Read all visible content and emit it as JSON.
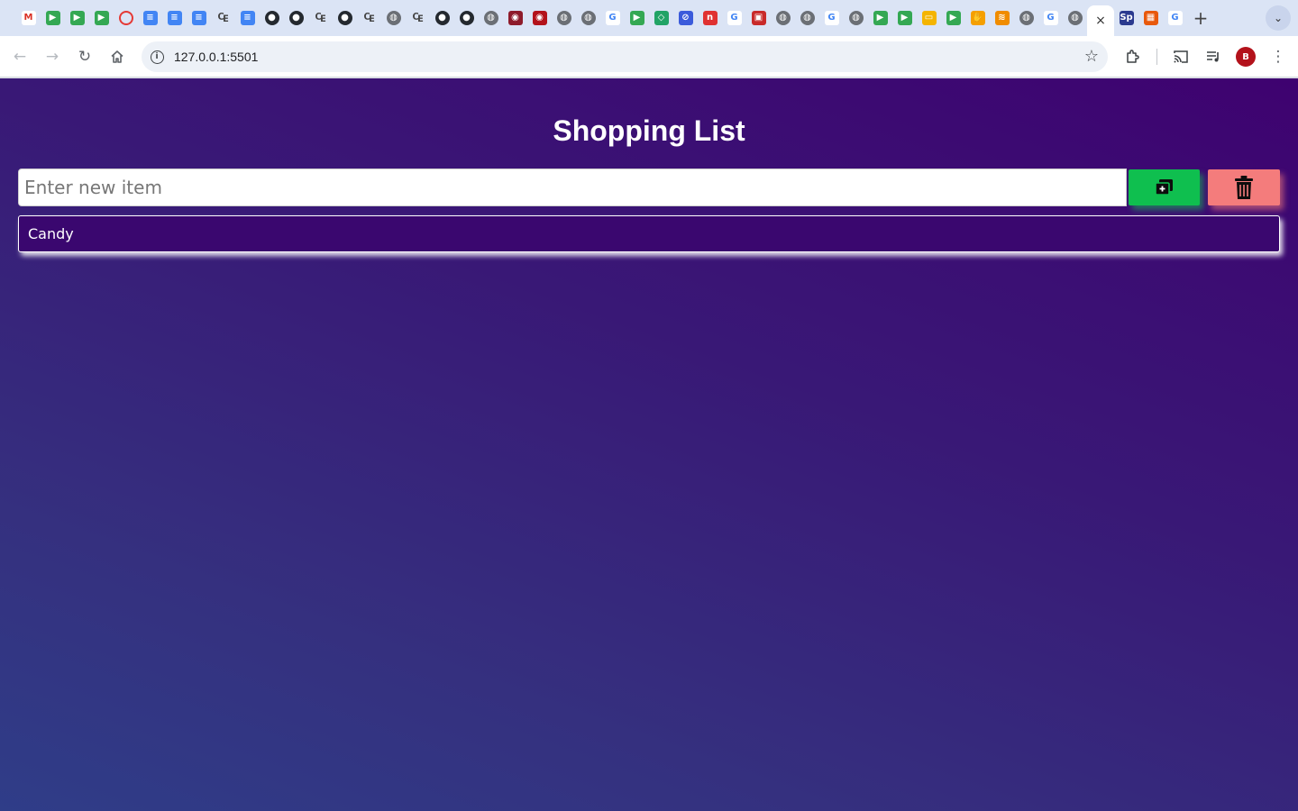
{
  "browser": {
    "url": "127.0.0.1:5501",
    "active_tab_close": "×",
    "new_tab": "+",
    "tab_search": "⌄",
    "profile_initial": "B",
    "tab_favicons": [
      {
        "name": "gmail-favicon",
        "glyph": "M",
        "color": "#ffffff",
        "text": "#d93025"
      },
      {
        "name": "meet-favicon",
        "glyph": "▶",
        "color": "#34a853"
      },
      {
        "name": "meet-favicon",
        "glyph": "▶",
        "color": "#34a853"
      },
      {
        "name": "meet-favicon",
        "glyph": "▶",
        "color": "#34a853"
      },
      {
        "name": "ring-favicon",
        "glyph": "",
        "color": "ring"
      },
      {
        "name": "docs-favicon",
        "glyph": "≡",
        "color": "#4285f4"
      },
      {
        "name": "docs-favicon",
        "glyph": "≡",
        "color": "#4285f4"
      },
      {
        "name": "docs-favicon",
        "glyph": "≡",
        "color": "#4285f4"
      },
      {
        "name": "site-favicon",
        "glyph": "₠",
        "color": "outline"
      },
      {
        "name": "docs-favicon",
        "glyph": "≡",
        "color": "#4285f4"
      },
      {
        "name": "github-favicon",
        "glyph": "●",
        "color": "#24292f"
      },
      {
        "name": "github-favicon",
        "glyph": "●",
        "color": "#24292f"
      },
      {
        "name": "site-favicon",
        "glyph": "₠",
        "color": "outline"
      },
      {
        "name": "github-favicon",
        "glyph": "●",
        "color": "#24292f"
      },
      {
        "name": "site-favicon",
        "glyph": "₠",
        "color": "outline"
      },
      {
        "name": "globe-favicon",
        "glyph": "◍",
        "color": "#6b6f75"
      },
      {
        "name": "site-favicon",
        "glyph": "₠",
        "color": "outline"
      },
      {
        "name": "github-favicon",
        "glyph": "●",
        "color": "#24292f"
      },
      {
        "name": "github-favicon",
        "glyph": "●",
        "color": "#24292f"
      },
      {
        "name": "globe-favicon",
        "glyph": "◍",
        "color": "#6b6f75"
      },
      {
        "name": "app-favicon",
        "glyph": "◉",
        "color": "#8e1b2b"
      },
      {
        "name": "app-favicon",
        "glyph": "◉",
        "color": "#b3121b"
      },
      {
        "name": "globe-favicon",
        "glyph": "◍",
        "color": "#6b6f75"
      },
      {
        "name": "globe-favicon",
        "glyph": "◍",
        "color": "#6b6f75"
      },
      {
        "name": "google-favicon",
        "glyph": "G",
        "color": "#ffffff",
        "text": "#4285f4"
      },
      {
        "name": "meet-favicon",
        "glyph": "▶",
        "color": "#34a853"
      },
      {
        "name": "code-favicon",
        "glyph": "◇",
        "color": "#21a366"
      },
      {
        "name": "app-favicon",
        "glyph": "⊘",
        "color": "#3b5bdb"
      },
      {
        "name": "app-favicon",
        "glyph": "n",
        "color": "#e03131"
      },
      {
        "name": "google-favicon",
        "glyph": "G",
        "color": "#ffffff",
        "text": "#4285f4"
      },
      {
        "name": "app-favicon",
        "glyph": "▣",
        "color": "#c92a2a"
      },
      {
        "name": "globe-favicon",
        "glyph": "◍",
        "color": "#6b6f75"
      },
      {
        "name": "globe-favicon",
        "glyph": "◍",
        "color": "#6b6f75"
      },
      {
        "name": "google-favicon",
        "glyph": "G",
        "color": "#ffffff",
        "text": "#4285f4"
      },
      {
        "name": "globe-favicon",
        "glyph": "◍",
        "color": "#6b6f75"
      },
      {
        "name": "meet-favicon",
        "glyph": "▶",
        "color": "#34a853"
      },
      {
        "name": "meet-favicon",
        "glyph": "▶",
        "color": "#34a853"
      },
      {
        "name": "slides-favicon",
        "glyph": "▭",
        "color": "#f4b400"
      },
      {
        "name": "meet-favicon",
        "glyph": "▶",
        "color": "#34a853"
      },
      {
        "name": "app-favicon",
        "glyph": "✋",
        "color": "#f59f00"
      },
      {
        "name": "app-favicon",
        "glyph": "≋",
        "color": "#f08c00"
      },
      {
        "name": "globe-favicon",
        "glyph": "◍",
        "color": "#6b6f75"
      },
      {
        "name": "google-favicon",
        "glyph": "G",
        "color": "#ffffff",
        "text": "#4285f4"
      },
      {
        "name": "globe-favicon",
        "glyph": "◍",
        "color": "#6b6f75"
      }
    ],
    "tab_favicons_after": [
      {
        "name": "sp-favicon",
        "glyph": "Sp",
        "color": "#2b3a8f"
      },
      {
        "name": "app-favicon",
        "glyph": "▦",
        "color": "#e8590c"
      },
      {
        "name": "google-favicon",
        "glyph": "G",
        "color": "#ffffff",
        "text": "#4285f4"
      }
    ]
  },
  "page": {
    "title": "Shopping List",
    "input_placeholder": "Enter new item",
    "input_value": "",
    "add_button_color": "#0fbf4f",
    "clear_button_color": "#f47c7c",
    "items": [
      "Candy"
    ]
  }
}
